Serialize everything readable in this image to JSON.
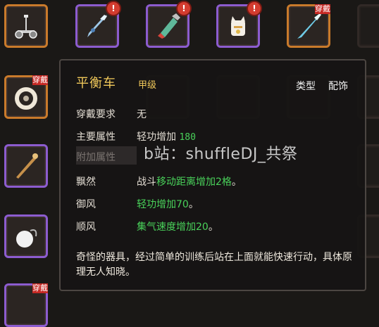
{
  "inventory": {
    "top_row": [
      {
        "name": "balance-scooter",
        "border": "orange",
        "alert": false,
        "wear": false
      },
      {
        "name": "crystal-spear",
        "border": "purple",
        "alert": true,
        "wear": false
      },
      {
        "name": "potion-vial",
        "border": "purple",
        "alert": true,
        "wear": false
      },
      {
        "name": "lucky-cat",
        "border": "purple",
        "alert": true,
        "wear": false
      },
      {
        "name": "blue-spear",
        "border": "orange",
        "alert": false,
        "wear": true
      }
    ],
    "left_column": [
      {
        "name": "ring-charm",
        "border": "orange",
        "wear": true
      },
      {
        "name": "wooden-staff",
        "border": "purple",
        "wear": false
      },
      {
        "name": "pearl-amulet",
        "border": "purple",
        "wear": false
      },
      {
        "name": "unknown-item",
        "border": "purple",
        "wear": true
      }
    ],
    "alert_glyph": "!",
    "wear_badge": "穿戴"
  },
  "tooltip": {
    "item_name": "平衡车",
    "grade": "甲级",
    "type_label": "类型",
    "type_value": "配饰",
    "requirement_label": "穿戴要求",
    "requirement_value": "无",
    "main_attr_label": "主要属性",
    "main_attr_value": "轻功增加",
    "main_attr_number": "180",
    "extra_attr_label": "附加属性",
    "watermark": "b站：shuffleDJ_共祭",
    "skills": [
      {
        "label": "飘然",
        "prefix": "战斗",
        "effect": "移动距离增加2格",
        "suffix": "。"
      },
      {
        "label": "御风",
        "prefix": "",
        "effect": "轻功增加70",
        "suffix": "。"
      },
      {
        "label": "顺风",
        "prefix": "",
        "effect": "集气速度增加20",
        "suffix": "。"
      }
    ],
    "description": "奇怪的器具，经过简单的训练后站在上面就能快速行动，具体原理无人知晓。"
  }
}
